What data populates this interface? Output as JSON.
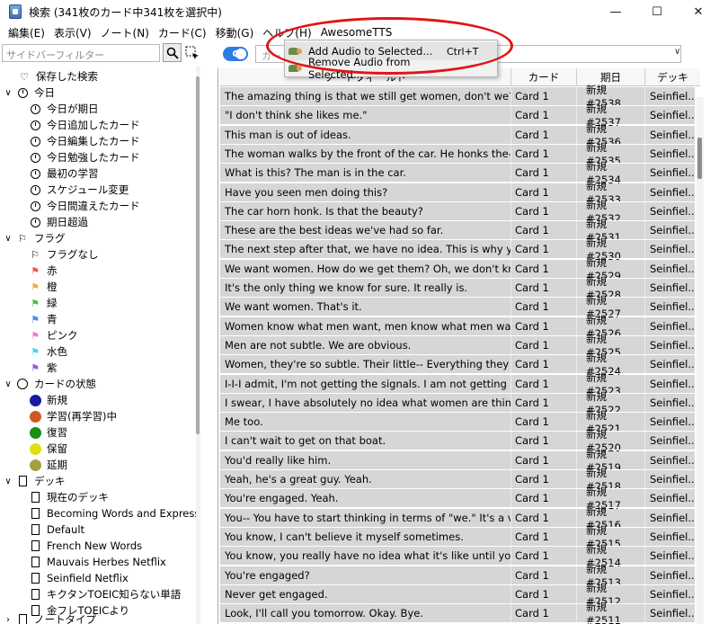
{
  "window": {
    "title": "検索 (341枚のカード中341枚を選択中)",
    "minimize": "—",
    "maximize": "☐",
    "close": "✕"
  },
  "menubar": [
    "編集(E)",
    "表示(V)",
    "ノート(N)",
    "カード(C)",
    "移動(G)",
    "ヘルプ(H)",
    "AwesomeTTS"
  ],
  "sidebar": {
    "filter_placeholder": "サイドバーフィルター",
    "saved_search": "保存した検索",
    "today": "今日",
    "today_items": [
      "今日が期日",
      "今日追加したカード",
      "今日編集したカード",
      "今日勉強したカード",
      "最初の学習",
      "スケジュール変更",
      "今日間違えたカード",
      "期日超過"
    ],
    "flag": "フラグ",
    "flag_items": [
      {
        "label": "フラグなし",
        "color": "#000000"
      },
      {
        "label": "赤",
        "color": "#f05a5a"
      },
      {
        "label": "橙",
        "color": "#f5a83b"
      },
      {
        "label": "緑",
        "color": "#48c048"
      },
      {
        "label": "青",
        "color": "#4a8ef0"
      },
      {
        "label": "ピンク",
        "color": "#f07ad0"
      },
      {
        "label": "水色",
        "color": "#48d8e0"
      },
      {
        "label": "紫",
        "color": "#9a58e0"
      }
    ],
    "card_state": "カードの状態",
    "state_items": [
      {
        "label": "新規",
        "color": "#1a1aa0"
      },
      {
        "label": "学習(再学習)中",
        "color": "#d0581e"
      },
      {
        "label": "復習",
        "color": "#159015"
      },
      {
        "label": "保留",
        "color": "#e0e010"
      },
      {
        "label": "延期",
        "color": "#a8a040"
      }
    ],
    "deck": "デッキ",
    "deck_items": [
      "現在のデッキ",
      "Becoming Words and Expressio...",
      "Default",
      "French New Words",
      "Mauvais Herbes Netflix",
      "Seinfield Netflix",
      "キクタンTOEIC知らない単語",
      "金フレTOEICより"
    ],
    "notetype": "ノートタイプ"
  },
  "main": {
    "toggle_label": "C",
    "search_placeholder": "カー",
    "columns": [
      "ソートフィールド",
      "カード",
      "期日",
      "デッキ"
    ],
    "rows": [
      [
        "The amazing thing is that we still get women, don't we? Men-- I ...",
        "Card 1",
        "新規 #2538",
        "Seinfiel..."
      ],
      [
        "\"I don't think she likes me.\"",
        "Card 1",
        "新規 #2537",
        "Seinfiel..."
      ],
      [
        "This man is out of ideas.",
        "Card 1",
        "新規 #2536",
        "Seinfiel..."
      ],
      [
        "The woman walks by the front of the car. He honks the--",
        "Card 1",
        "新規 #2535",
        "Seinfiel..."
      ],
      [
        "What is this? The man is in the car.",
        "Card 1",
        "新規 #2534",
        "Seinfiel..."
      ],
      [
        "Have you seen men doing this?",
        "Card 1",
        "新規 #2533",
        "Seinfiel..."
      ],
      [
        "The car horn honk. Is that the beauty?",
        "Card 1",
        "新規 #2532",
        "Seinfiel..."
      ],
      [
        "These are the best ideas we've had so far.",
        "Card 1",
        "新規 #2531",
        "Seinfiel..."
      ],
      [
        "The next step after that, we have no idea. This is why you see m...",
        "Card 1",
        "新規 #2530",
        "Seinfiel..."
      ],
      [
        "We want women. How do we get them? Oh, we don't know abou...",
        "Card 1",
        "新規 #2529",
        "Seinfiel..."
      ],
      [
        "It's the only thing we know for sure. It really is.",
        "Card 1",
        "新規 #2528",
        "Seinfiel..."
      ],
      [
        "We want women. That's it.",
        "Card 1",
        "新規 #2527",
        "Seinfiel..."
      ],
      [
        "Women know what men want, men know what men want. What ...",
        "Card 1",
        "新規 #2526",
        "Seinfiel..."
      ],
      [
        "Men are not subtle. We are obvious.",
        "Card 1",
        "新規 #2525",
        "Seinfiel..."
      ],
      [
        "Women, they're so subtle. Their little-- Everything they do is subtle.",
        "Card 1",
        "新規 #2524",
        "Seinfiel..."
      ],
      [
        "I-I-I admit, I'm not getting the signals. I am not getting it.",
        "Card 1",
        "新規 #2523",
        "Seinfiel..."
      ],
      [
        "I swear, I have absolutely no idea what women are thinking. I do...",
        "Card 1",
        "新規 #2522",
        "Seinfiel..."
      ],
      [
        "Me too.",
        "Card 1",
        "新規 #2521",
        "Seinfiel..."
      ],
      [
        "I can't wait to get on that boat.",
        "Card 1",
        "新規 #2520",
        "Seinfiel..."
      ],
      [
        "You'd really like him.",
        "Card 1",
        "新規 #2519",
        "Seinfiel..."
      ],
      [
        "Yeah, he's a great guy. Yeah.",
        "Card 1",
        "新規 #2518",
        "Seinfiel..."
      ],
      [
        "You're engaged. Yeah.",
        "Card 1",
        "新規 #2517",
        "Seinfiel..."
      ],
      [
        "You-- You have to start thinking in terms of \"we.\" It's a very stress...",
        "Card 1",
        "新規 #2516",
        "Seinfiel..."
      ],
      [
        "You know, I can't believe it myself sometimes.",
        "Card 1",
        "新規 #2515",
        "Seinfiel..."
      ],
      [
        "You know, you really have no idea what it's like until you actually ...",
        "Card 1",
        "新規 #2514",
        "Seinfiel..."
      ],
      [
        "You're engaged?",
        "Card 1",
        "新規 #2513",
        "Seinfiel..."
      ],
      [
        "Never get engaged.",
        "Card 1",
        "新規 #2512",
        "Seinfiel..."
      ],
      [
        "Look, I'll call you tomorrow. Okay. Bye.",
        "Card 1",
        "新規 #2511",
        "Seinfiel..."
      ]
    ]
  },
  "popup": {
    "items": [
      {
        "label": "Add Audio to Selected...",
        "shortcut": "Ctrl+T"
      },
      {
        "label": "Remove Audio from Selected...",
        "shortcut": ""
      }
    ]
  },
  "colors": {
    "accent": "#2f7de1",
    "highlight_ellipse": "#e01515",
    "row_selected": "#d6d6d6"
  }
}
